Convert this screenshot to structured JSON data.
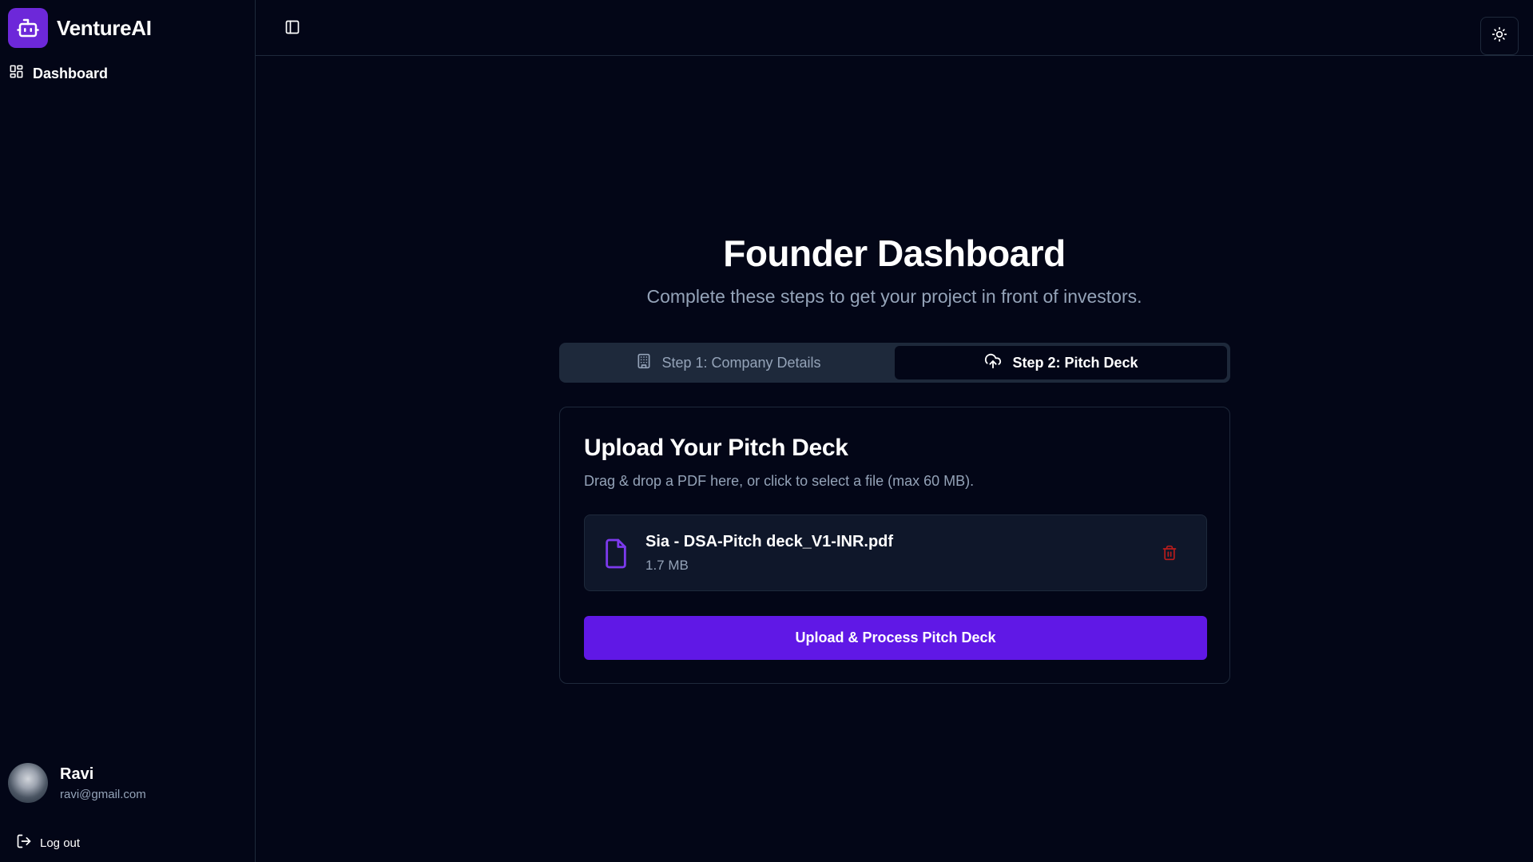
{
  "brand": {
    "name": "VentureAI",
    "icon": "bot-icon",
    "accent": "#6d28d9"
  },
  "sidebar": {
    "nav": [
      {
        "label": "Dashboard",
        "icon": "layout-grid-icon"
      }
    ],
    "user": {
      "name": "Ravi",
      "email": "ravi@gmail.com"
    },
    "logout_label": "Log out"
  },
  "topbar": {
    "toggle_icon": "panel-left-icon",
    "theme_icon": "sun-icon"
  },
  "main": {
    "title": "Founder Dashboard",
    "subtitle": "Complete these steps to get your project in front of investors.",
    "tabs": [
      {
        "label": "Step 1: Company Details",
        "icon": "building-icon",
        "active": false
      },
      {
        "label": "Step 2: Pitch Deck",
        "icon": "cloud-upload-icon",
        "active": true
      }
    ],
    "card": {
      "title": "Upload Your Pitch Deck",
      "description": "Drag & drop a PDF here, or click to select a file (max 60 MB).",
      "file": {
        "name": "Sia - DSA-Pitch deck_V1-INR.pdf",
        "size": "1.7 MB",
        "icon": "file-icon"
      },
      "button_label": "Upload & Process Pitch Deck",
      "button_color": "#6018e6"
    }
  }
}
